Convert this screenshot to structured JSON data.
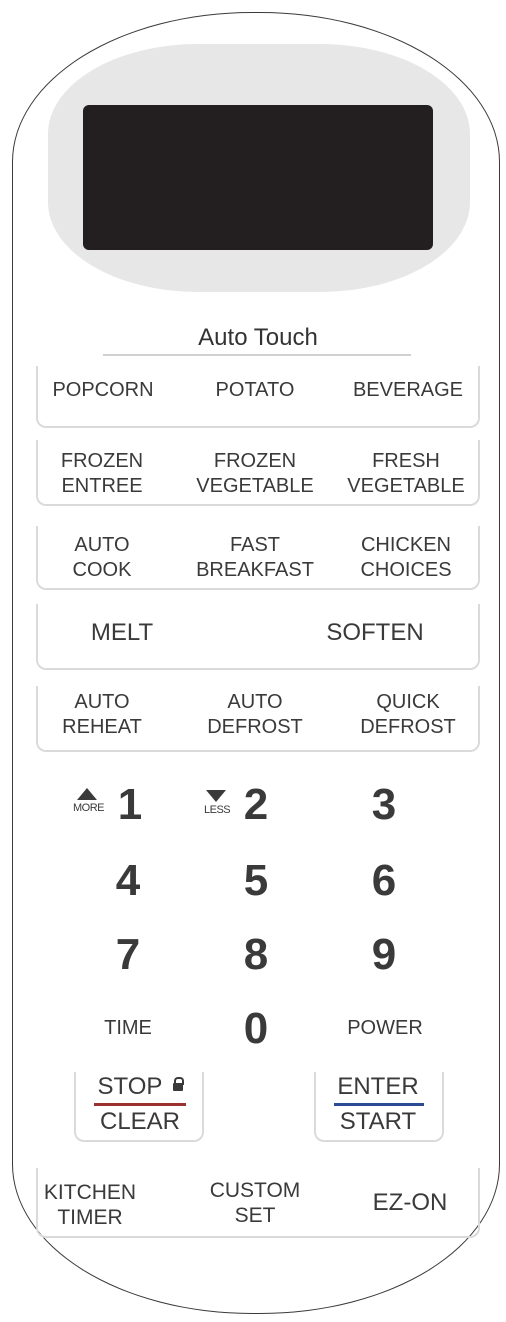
{
  "display": {
    "text": ""
  },
  "section_title": "Auto Touch",
  "rows": {
    "row1": [
      "POPCORN",
      "POTATO",
      "BEVERAGE"
    ],
    "row2": [
      [
        "FROZEN",
        "ENTREE"
      ],
      [
        "FROZEN",
        "VEGETABLE"
      ],
      [
        "FRESH",
        "VEGETABLE"
      ]
    ],
    "row3": [
      [
        "AUTO",
        "COOK"
      ],
      [
        "FAST",
        "BREAKFAST"
      ],
      [
        "CHICKEN",
        "CHOICES"
      ]
    ],
    "row4": [
      "MELT",
      "SOFTEN"
    ],
    "row5": [
      [
        "AUTO",
        "REHEAT"
      ],
      [
        "AUTO",
        "DEFROST"
      ],
      [
        "QUICK",
        "DEFROST"
      ]
    ]
  },
  "keypad": {
    "more": "MORE",
    "less": "LESS",
    "digits": [
      "1",
      "2",
      "3",
      "4",
      "5",
      "6",
      "7",
      "8",
      "9",
      "0"
    ],
    "time": "TIME",
    "power": "POWER"
  },
  "controls": {
    "stop": "STOP",
    "clear": "CLEAR",
    "enter": "ENTER",
    "start": "START"
  },
  "bottom": {
    "kitchen": [
      "KITCHEN",
      "TIMER"
    ],
    "custom": [
      "CUSTOM",
      "SET"
    ],
    "ezon": "EZ-ON"
  },
  "colors": {
    "stop_underline": "#9b3030",
    "enter_underline": "#2b4c94"
  }
}
